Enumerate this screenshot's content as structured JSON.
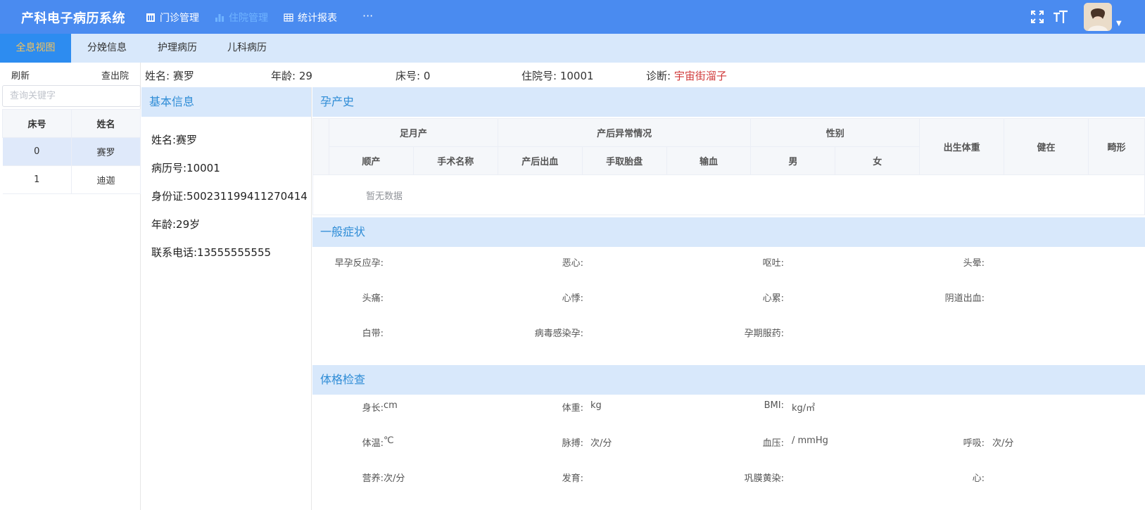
{
  "app": {
    "title": "产科电子病历系统"
  },
  "nav": {
    "items": [
      {
        "label": "门诊管理",
        "icon": "table-icon"
      },
      {
        "label": "住院管理",
        "icon": "bar-chart-icon"
      },
      {
        "label": "统计报表",
        "icon": "grid-icon"
      }
    ],
    "more": "···"
  },
  "header_icons": [
    "fullscreen-icon",
    "font-size-icon",
    "avatar",
    "chevron-down-icon"
  ],
  "tabs": [
    {
      "label": "全息视图"
    },
    {
      "label": "分娩信息"
    },
    {
      "label": "护理病历"
    },
    {
      "label": "儿科病历"
    }
  ],
  "sidebar": {
    "refresh": "刷新",
    "discharge": "查出院",
    "search_placeholder": "查询关键字",
    "columns": [
      "床号",
      "姓名"
    ],
    "rows": [
      {
        "bed": "0",
        "name": "赛罗"
      },
      {
        "bed": "1",
        "name": "迪迦"
      }
    ]
  },
  "patient": {
    "name_label": "姓名:",
    "name": "赛罗",
    "age_label": "年龄:",
    "age": "29",
    "bed_label": "床号:",
    "bed": "0",
    "admission_label": "住院号:",
    "admission": "10001",
    "diagnosis_label": "诊断:",
    "diagnosis": "宇宙街溜子"
  },
  "basic": {
    "title": "基本信息",
    "lines": [
      "姓名:赛罗",
      "病历号:10001",
      "身份证:500231199411270414",
      "年龄:29岁",
      "联系电话:13555555555"
    ]
  },
  "pregnancy": {
    "title": "孕产史",
    "groups": {
      "term": "足月产",
      "postpartum": "产后异常情况",
      "sex": "性别"
    },
    "sub": [
      "顺产",
      "手术名称",
      "产后出血",
      "手取胎盘",
      "输血",
      "男",
      "女"
    ],
    "single": [
      "出生体重",
      "健在",
      "畸形"
    ],
    "empty": "暂无数据"
  },
  "symptoms": {
    "title": "一般症状",
    "rows": [
      [
        "早孕反应孕:",
        "恶心:",
        "呕吐:",
        "头晕:"
      ],
      [
        "头痛:",
        "心悸:",
        "心累:",
        "阴道出血:"
      ],
      [
        "白带:",
        "病毒感染孕:",
        "孕期服药:"
      ]
    ]
  },
  "physical": {
    "title": "体格检查",
    "rows": [
      [
        {
          "label": "身长:",
          "unit": "cm"
        },
        {
          "label": "体重:",
          "unit": "kg"
        },
        {
          "label": "BMI:",
          "unit": "kg/㎡"
        }
      ],
      [
        {
          "label": "体温:",
          "unit": "℃"
        },
        {
          "label": "脉搏:",
          "unit": "次/分"
        },
        {
          "label": "血压:",
          "unit": "/ mmHg"
        },
        {
          "label": "呼吸:",
          "unit": "次/分"
        }
      ],
      [
        {
          "label": "营养:",
          "unit": "次/分"
        },
        {
          "label": "发育:",
          "unit": ""
        },
        {
          "label": "巩膜黄染:",
          "unit": ""
        },
        {
          "label": "心:",
          "unit": ""
        }
      ]
    ]
  },
  "colors": {
    "primary": "#4a8bf0",
    "tab_bg": "#d8e8fb",
    "active_tab": "#2d8cf0",
    "section_title": "#2e8cd6",
    "diagnosis": "#d03a3a"
  }
}
